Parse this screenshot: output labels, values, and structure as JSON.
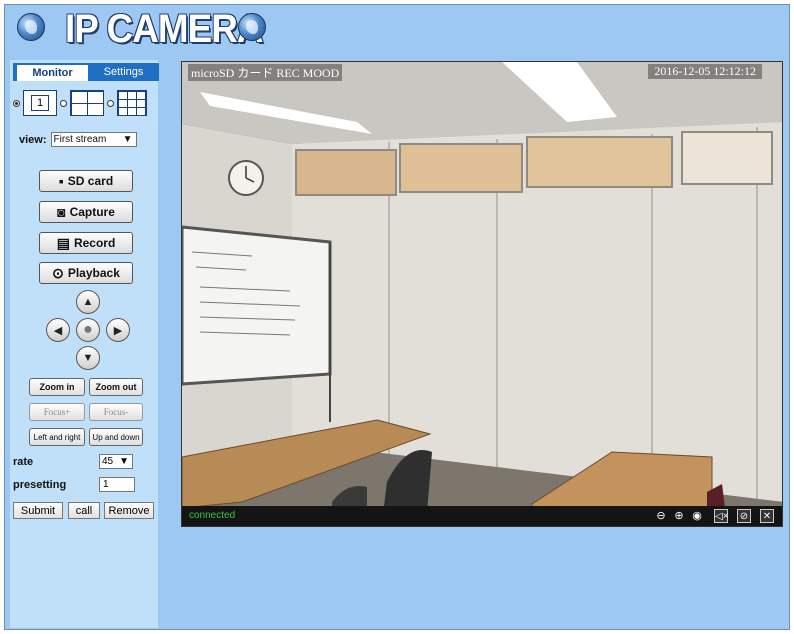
{
  "header": {
    "title": "IP CAMERA"
  },
  "tabs": [
    {
      "label": "Monitor"
    },
    {
      "label": "Settings"
    }
  ],
  "layout": {
    "single_label": "1"
  },
  "view": {
    "label": "view:",
    "selected": "First stream"
  },
  "buttons": {
    "sd_card": "SD card",
    "capture": "Capture",
    "record": "Record",
    "playback": "Playback"
  },
  "ptz": {
    "zoom_in": "Zoom in",
    "zoom_out": "Zoom out",
    "focus_plus": "Focus+",
    "focus_minus": "Focus-",
    "left_right": "Left and right",
    "up_down": "Up and down"
  },
  "rate": {
    "label": "rate",
    "selected": "45"
  },
  "presetting": {
    "label": "presetting",
    "value": "1"
  },
  "form": {
    "submit": "Submit",
    "call": "call",
    "remove": "Remove"
  },
  "video": {
    "overlay_title": "microSD カード REC MOOD",
    "timestamp": "2016-12-05 12:12:12",
    "status": "connected"
  },
  "colors": {
    "page_bg": "#9cc8f2",
    "sidebar_bg": "#bfe0f8",
    "tab_active": "#1f6fc4",
    "status_green": "#39c04a"
  }
}
